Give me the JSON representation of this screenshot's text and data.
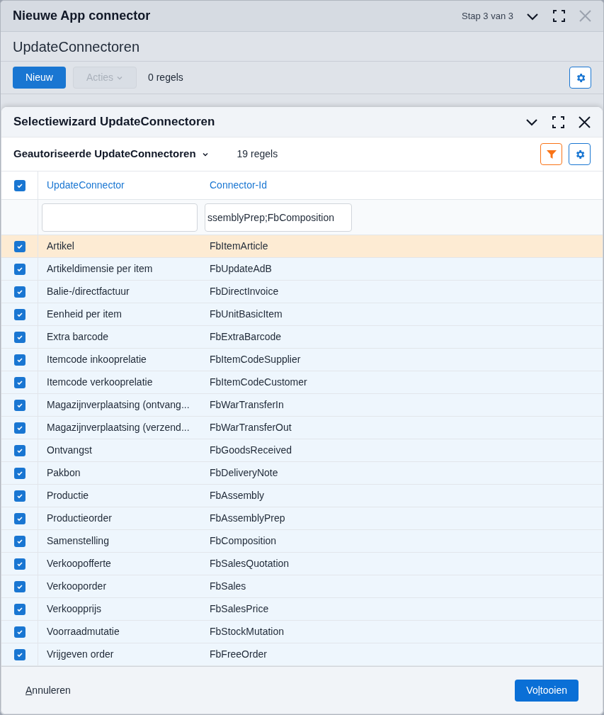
{
  "window": {
    "title": "Nieuwe App connector",
    "step": "Stap 3 van 3"
  },
  "page": {
    "title": "UpdateConnectoren",
    "toolbar": {
      "new_button": "Nieuw",
      "actions_button": {
        "label": "Acties",
        "disabled": true
      },
      "count": "0 regels"
    }
  },
  "dialog": {
    "title": "Selectiewizard UpdateConnectoren",
    "view": "Geautoriseerde UpdateConnectoren",
    "count": "19 regels",
    "table": {
      "all_checked": true,
      "columns": [
        "UpdateConnector",
        "Connector-Id"
      ],
      "filters": [
        {
          "kind": "text"
        },
        {
          "kind": "text",
          "value": "ssemblyPrep;FbComposition"
        }
      ],
      "rows": [
        {
          "name": "Artikel",
          "id": "FbItemArticle",
          "checked": true,
          "selected": true
        },
        {
          "name": "Artikeldimensie per item",
          "id": "FbUpdateAdB",
          "checked": true,
          "selected": false
        },
        {
          "name": "Balie-/directfactuur",
          "id": "FbDirectInvoice",
          "checked": true,
          "selected": false
        },
        {
          "name": "Eenheid per item",
          "id": "FbUnitBasicItem",
          "checked": true,
          "selected": false
        },
        {
          "name": "Extra barcode",
          "id": "FbExtraBarcode",
          "checked": true,
          "selected": false
        },
        {
          "name": "Itemcode inkooprelatie",
          "id": "FbItemCodeSupplier",
          "checked": true,
          "selected": false
        },
        {
          "name": "Itemcode verkooprelatie",
          "id": "FbItemCodeCustomer",
          "checked": true,
          "selected": false
        },
        {
          "name": "Magazijnverplaatsing (ontvang...",
          "id": "FbWarTransferIn",
          "checked": true,
          "selected": false
        },
        {
          "name": "Magazijnverplaatsing (verzend...",
          "id": "FbWarTransferOut",
          "checked": true,
          "selected": false
        },
        {
          "name": "Ontvangst",
          "id": "FbGoodsReceived",
          "checked": true,
          "selected": false
        },
        {
          "name": "Pakbon",
          "id": "FbDeliveryNote",
          "checked": true,
          "selected": false
        },
        {
          "name": "Productie",
          "id": "FbAssembly",
          "checked": true,
          "selected": false
        },
        {
          "name": "Productieorder",
          "id": "FbAssemblyPrep",
          "checked": true,
          "selected": false
        },
        {
          "name": "Samenstelling",
          "id": "FbComposition",
          "checked": true,
          "selected": false
        },
        {
          "name": "Verkoopofferte",
          "id": "FbSalesQuotation",
          "checked": true,
          "selected": false
        },
        {
          "name": "Verkooporder",
          "id": "FbSales",
          "checked": true,
          "selected": false
        },
        {
          "name": "Verkoopprijs",
          "id": "FbSalesPrice",
          "checked": true,
          "selected": false
        },
        {
          "name": "Voorraadmutatie",
          "id": "FbStockMutation",
          "checked": true,
          "selected": false
        },
        {
          "name": "Vrijgeven order",
          "id": "FbFreeOrder",
          "checked": true,
          "selected": false
        }
      ]
    },
    "footer": {
      "cancel": {
        "key": "A",
        "after": "nnuleren"
      },
      "finish": {
        "before": "Vo",
        "key": "l",
        "after": "tooien"
      }
    }
  }
}
